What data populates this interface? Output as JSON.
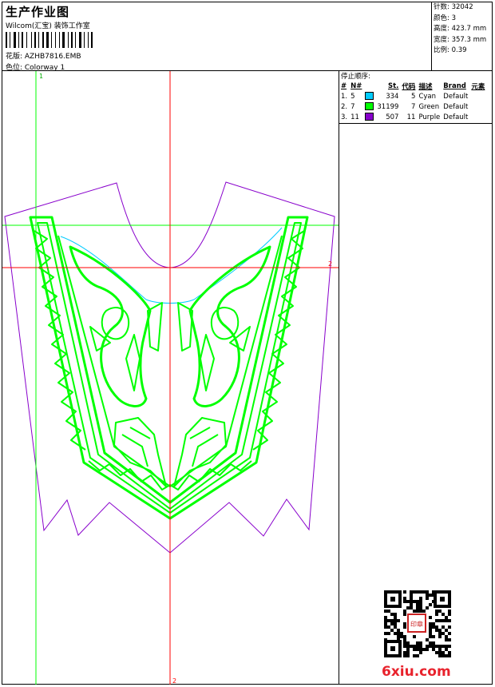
{
  "header": {
    "title": "生产作业图",
    "company": "Wilcom(汇宝) 装饰工作室",
    "pattern": "花版:  AZHB7816.EMB",
    "color": "色位:  Colorway 1"
  },
  "stats": [
    {
      "label": "针数:",
      "value": "32042"
    },
    {
      "label": "颜色:",
      "value": "3"
    },
    {
      "label": "高度:",
      "value": "423.7 mm"
    },
    {
      "label": "宽度:",
      "value": "357.3 mm"
    },
    {
      "label": "比例:",
      "value": "0.39"
    }
  ],
  "stop_sequence": {
    "label": "停止顺序:",
    "headers": [
      "#",
      "N#",
      "St.",
      "代码",
      "描述",
      "Brand",
      "元素"
    ],
    "rows": [
      {
        "index": "1.",
        "needle": "5",
        "color_hex": "#00ccff",
        "stitches": "334",
        "code": "5",
        "desc": "Cyan",
        "brand": "Default"
      },
      {
        "index": "2.",
        "needle": "7",
        "color_hex": "#00ff00",
        "stitches": "31199",
        "code": "7",
        "desc": "Green",
        "brand": "Default"
      },
      {
        "index": "3.",
        "needle": "11",
        "color_hex": "#8800cc",
        "stitches": "507",
        "code": "11",
        "desc": "Purple",
        "brand": "Default"
      }
    ]
  },
  "guides": {
    "green_label": "1",
    "red_label": "2",
    "red_label_h": "2"
  },
  "watermark": {
    "brand_text": "6xiu.com",
    "seal_text": "印章"
  },
  "colors": {
    "purple": "#8800cc",
    "green": "#00ff00",
    "cyan": "#00ccff",
    "red": "#ff0000"
  }
}
